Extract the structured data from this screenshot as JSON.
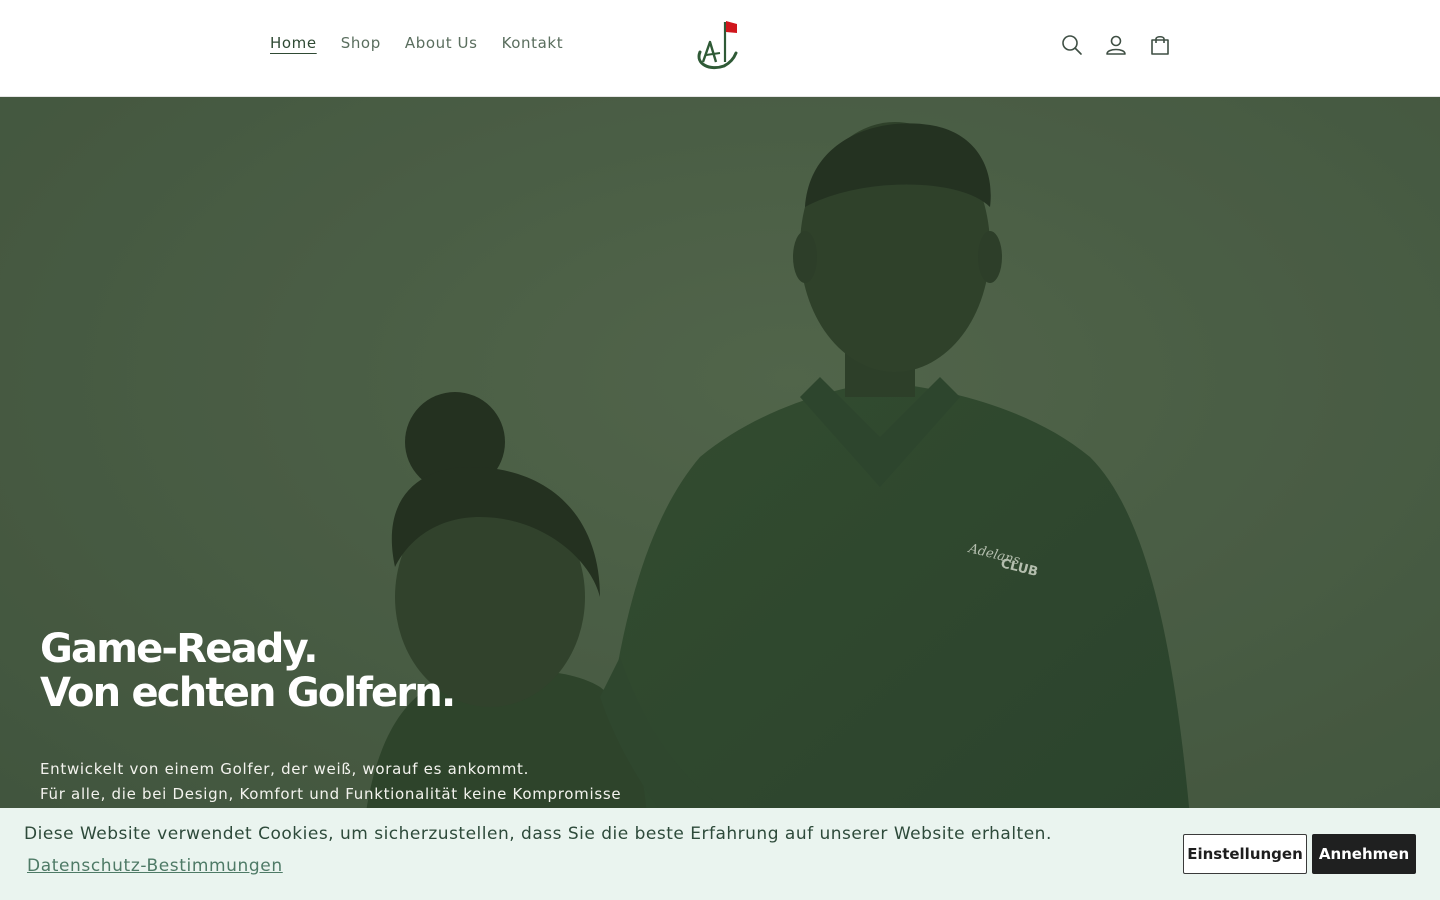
{
  "nav": {
    "items": [
      {
        "label": "Home",
        "active": true
      },
      {
        "label": "Shop",
        "active": false
      },
      {
        "label": "About Us",
        "active": false
      },
      {
        "label": "Kontakt",
        "active": false
      }
    ]
  },
  "logo": {
    "text": "A",
    "flag_color": "#d0161c",
    "brand_color": "#2f5a36"
  },
  "header_icons": [
    "search-icon",
    "account-icon",
    "cart-icon"
  ],
  "hero": {
    "title_line1": "Game-Ready.",
    "title_line2": "Von echten Golfern.",
    "subtitle_line1": "Entwickelt von einem Golfer, der weiß, worauf es ankommt.",
    "subtitle_line2": "Für alle, die bei Design, Komfort und Funktionalität keine Kompromisse",
    "shirt_print": "Adelans CLUB",
    "overlay_color": "#3f5538"
  },
  "cookie": {
    "message": "Diese Website verwendet Cookies, um sicherzustellen, dass Sie die beste Erfahrung auf unserer Website erhalten.",
    "privacy_link": "Datenschutz-Bestimmungen",
    "settings_label": "Einstellungen",
    "accept_label": "Annehmen"
  }
}
